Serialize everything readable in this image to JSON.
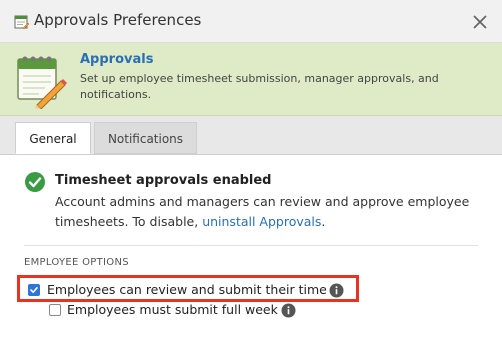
{
  "window": {
    "title": "Approvals Preferences",
    "icons": {
      "title": "calendar-icon",
      "close": "close-icon"
    }
  },
  "banner": {
    "title": "Approvals",
    "description": "Set up employee timesheet submission, manager approvals, and notifications.",
    "icon": "calendar-pencil-icon",
    "background_color": "#dfeac6",
    "title_color": "#2a6fb5"
  },
  "tabs": [
    {
      "label": "General",
      "active": true
    },
    {
      "label": "Notifications",
      "active": false
    }
  ],
  "status": {
    "title": "Timesheet approvals enabled",
    "description_before": "Account admins and managers can review and approve employee timesheets. To disable, ",
    "link_text": "uninstall Approvals",
    "description_after": ".",
    "icon": "check-circle-icon",
    "icon_color": "#3a9b45"
  },
  "employee_options": {
    "section_label": "EMPLOYEE OPTIONS",
    "options": [
      {
        "label": "Employees can review and submit their time",
        "checked": true,
        "highlighted": true,
        "info_icon": "info-icon"
      },
      {
        "label": "Employees must submit full week",
        "checked": false,
        "highlighted": false,
        "info_icon": "info-icon"
      }
    ],
    "highlight_color": "#e53324",
    "checkbox_color": "#2d75d6"
  }
}
